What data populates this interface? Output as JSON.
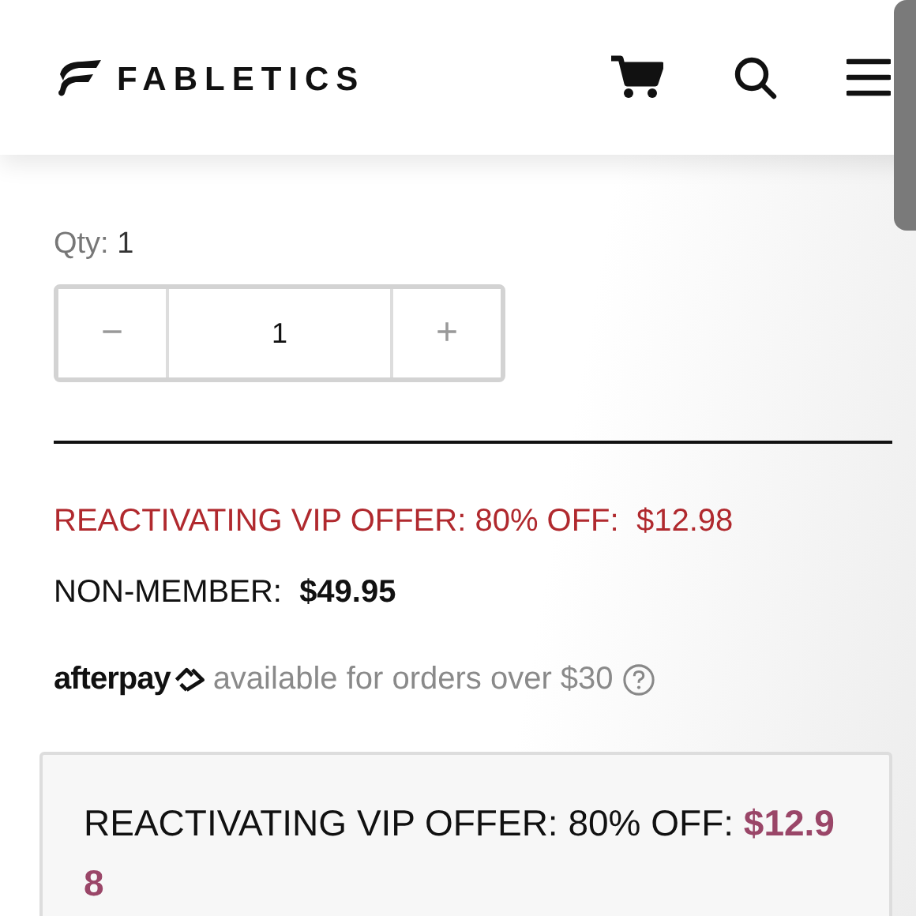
{
  "header": {
    "logo": "FABLETICS"
  },
  "quantity": {
    "label": "Qty:",
    "value": "1",
    "decrement": "−",
    "increment": "+",
    "input_value": "1"
  },
  "offer": {
    "label": "REACTIVATING VIP OFFER: 80% OFF:",
    "price": "$12.98"
  },
  "non_member": {
    "label": "NON-MEMBER:",
    "price": "$49.95"
  },
  "afterpay": {
    "brand": "afterpay",
    "text": "available for orders over $30"
  },
  "offer_box": {
    "label": "REACTIVATING VIP OFFER: 80% OFF:",
    "price": "$12.98"
  }
}
